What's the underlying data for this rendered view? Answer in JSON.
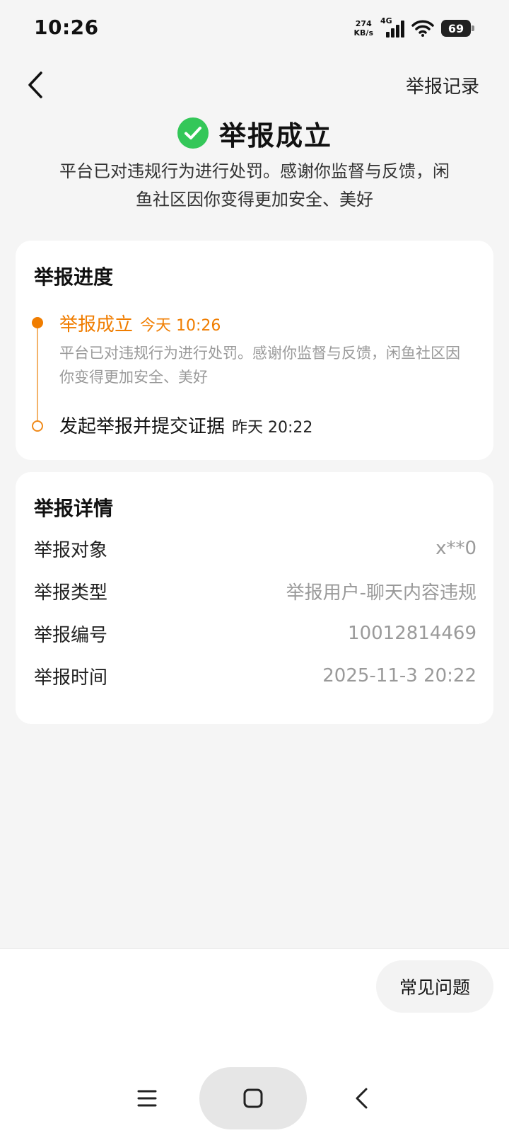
{
  "status_bar": {
    "time": "10:26",
    "net_speed_value": "274",
    "net_speed_unit": "KB/s",
    "network_type": "4G",
    "battery": "69"
  },
  "header": {
    "back_icon": "chevron-left-icon",
    "records_label": "举报记录"
  },
  "result": {
    "icon": "check-circle-icon",
    "icon_color": "#34c759",
    "title": "举报成立",
    "description": "平台已对违规行为进行处罚。感谢你监督与反馈，闲鱼社区因你变得更加安全、美好"
  },
  "progress": {
    "title": "举报进度",
    "accent_color": "#f07d00",
    "steps": [
      {
        "label": "举报成立",
        "time": "今天 10:26",
        "description": "平台已对违规行为进行处罚。感谢你监督与反馈，闲鱼社区因你变得更加安全、美好",
        "active": true
      },
      {
        "label": "发起举报并提交证据",
        "time": "昨天 20:22",
        "active": false
      }
    ]
  },
  "details": {
    "title": "举报详情",
    "rows": [
      {
        "label": "举报对象",
        "value": "x**0"
      },
      {
        "label": "举报类型",
        "value": "举报用户-聊天内容违规"
      },
      {
        "label": "举报编号",
        "value": "10012814469"
      },
      {
        "label": "举报时间",
        "value": "2025-11-3 20:22"
      }
    ]
  },
  "footer": {
    "faq_label": "常见问题"
  },
  "nav": {
    "menu_icon": "menu-icon",
    "home_icon": "home-square-icon",
    "back_icon": "back-chevron-icon"
  }
}
